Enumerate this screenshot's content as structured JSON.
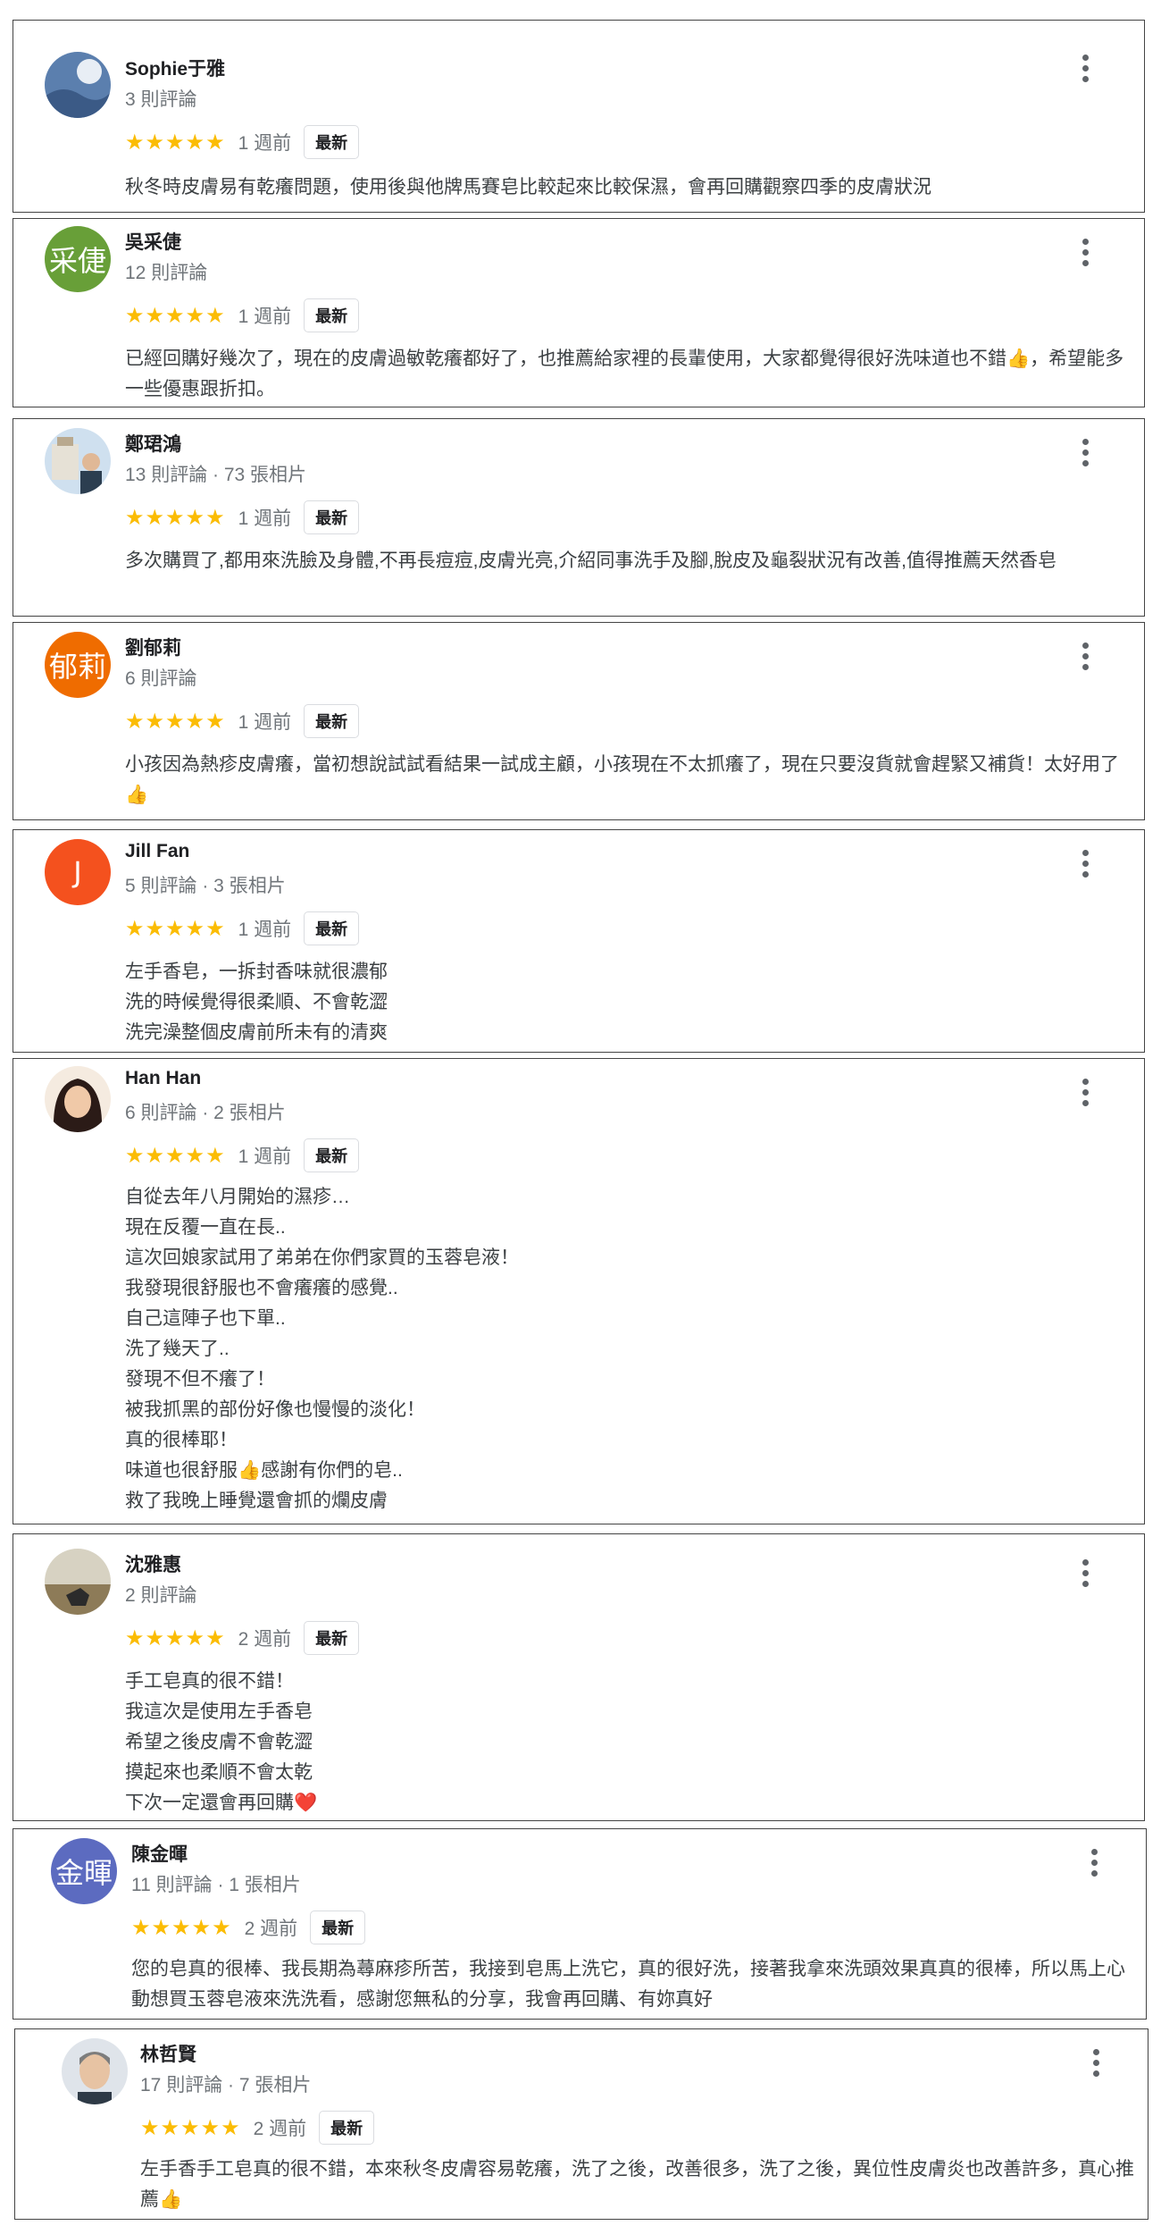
{
  "reviews": [
    {
      "name": "Sophie于雅",
      "meta": "3 則評論",
      "stars": "★★★★★",
      "when": "1 週前",
      "badge": "最新",
      "text": "秋冬時皮膚易有乾癢問題，使用後與他牌馬賽皂比較起來比較保濕，會再回購觀察四季的皮膚狀況",
      "avatar": "photo",
      "avatar_color": "#6d8fb8"
    },
    {
      "name": "吳采倢",
      "meta": "12 則評論",
      "stars": "★★★★★",
      "when": "1 週前",
      "badge": "最新",
      "text": "已經回購好幾次了，現在的皮膚過敏乾癢都好了，也推薦給家裡的長輩使用，大家都覺得很好洗味道也不錯👍，希望能多一些優惠跟折扣。",
      "avatar": "采倢",
      "avatar_color": "#689f38"
    },
    {
      "name": "鄭珺鴻",
      "meta": "13 則評論 · 73 張相片",
      "stars": "★★★★★",
      "when": "1 週前",
      "badge": "最新",
      "text": "多次購買了,都用來洗臉及身體,不再長痘痘,皮膚光亮,介紹同事洗手及腳,脫皮及龜裂狀況有改善,值得推薦天然香皂",
      "avatar": "photo",
      "avatar_color": "#9bb7d4"
    },
    {
      "name": "劉郁莉",
      "meta": "6 則評論",
      "stars": "★★★★★",
      "when": "1 週前",
      "badge": "最新",
      "text": "小孩因為熱疹皮膚癢，當初想說試試看結果一試成主顧，小孩現在不太抓癢了，現在只要沒貨就會趕緊又補貨！太好用了👍",
      "avatar": "郁莉",
      "avatar_color": "#ef6c00"
    },
    {
      "name": "Jill Fan",
      "meta": "5 則評論 · 3 張相片",
      "stars": "★★★★★",
      "when": "1 週前",
      "badge": "最新",
      "text": "左手香皂，一拆封香味就很濃郁\n洗的時候覺得很柔順、不會乾澀\n洗完澡整個皮膚前所未有的清爽",
      "avatar": "J",
      "avatar_color": "#f4511e"
    },
    {
      "name": "Han Han",
      "meta": "6 則評論 · 2 張相片",
      "stars": "★★★★★",
      "when": "1 週前",
      "badge": "最新",
      "text": "自從去年八月開始的濕疹…\n現在反覆一直在長..\n這次回娘家試用了弟弟在你們家買的玉蓉皂液！\n我發現很舒服也不會癢癢的感覺..\n自己這陣子也下單..\n洗了幾天了..\n發現不但不癢了！\n被我抓黑的部份好像也慢慢的淡化！\n真的很棒耶！\n味道也很舒服👍感謝有你們的皂..\n救了我晚上睡覺還會抓的爛皮膚",
      "avatar": "photo",
      "avatar_color": "#3e2723"
    },
    {
      "name": "沈雅惠",
      "meta": "2 則評論",
      "stars": "★★★★★",
      "when": "2 週前",
      "badge": "最新",
      "text": "手工皂真的很不錯！\n我這次是使用左手香皂\n希望之後皮膚不會乾澀\n摸起來也柔順不會太乾\n下次一定還會再回購❤️",
      "avatar": "photo",
      "avatar_color": "#a1887f"
    },
    {
      "name": "陳金暉",
      "meta": "11 則評論 · 1 張相片",
      "stars": "★★★★★",
      "when": "2 週前",
      "badge": "最新",
      "text": "您的皂真的很棒、我長期為蕁麻疹所苦，我接到皂馬上洗它，真的很好洗，接著我拿來洗頭效果真真的很棒，所以馬上心動想買玉蓉皂液來洗洗看，感謝您無私的分享，我會再回購、有妳真好",
      "avatar": "金暉",
      "avatar_color": "#5c6bc0"
    },
    {
      "name": "林哲賢",
      "meta": "17 則評論 · 7 張相片",
      "stars": "★★★★★",
      "when": "2 週前",
      "badge": "最新",
      "text": "左手香手工皂真的很不錯，本來秋冬皮膚容易乾癢，洗了之後，改善很多，洗了之後，異位性皮膚炎也改善許多，真心推薦👍",
      "avatar": "photo",
      "avatar_color": "#b0bec5"
    }
  ]
}
